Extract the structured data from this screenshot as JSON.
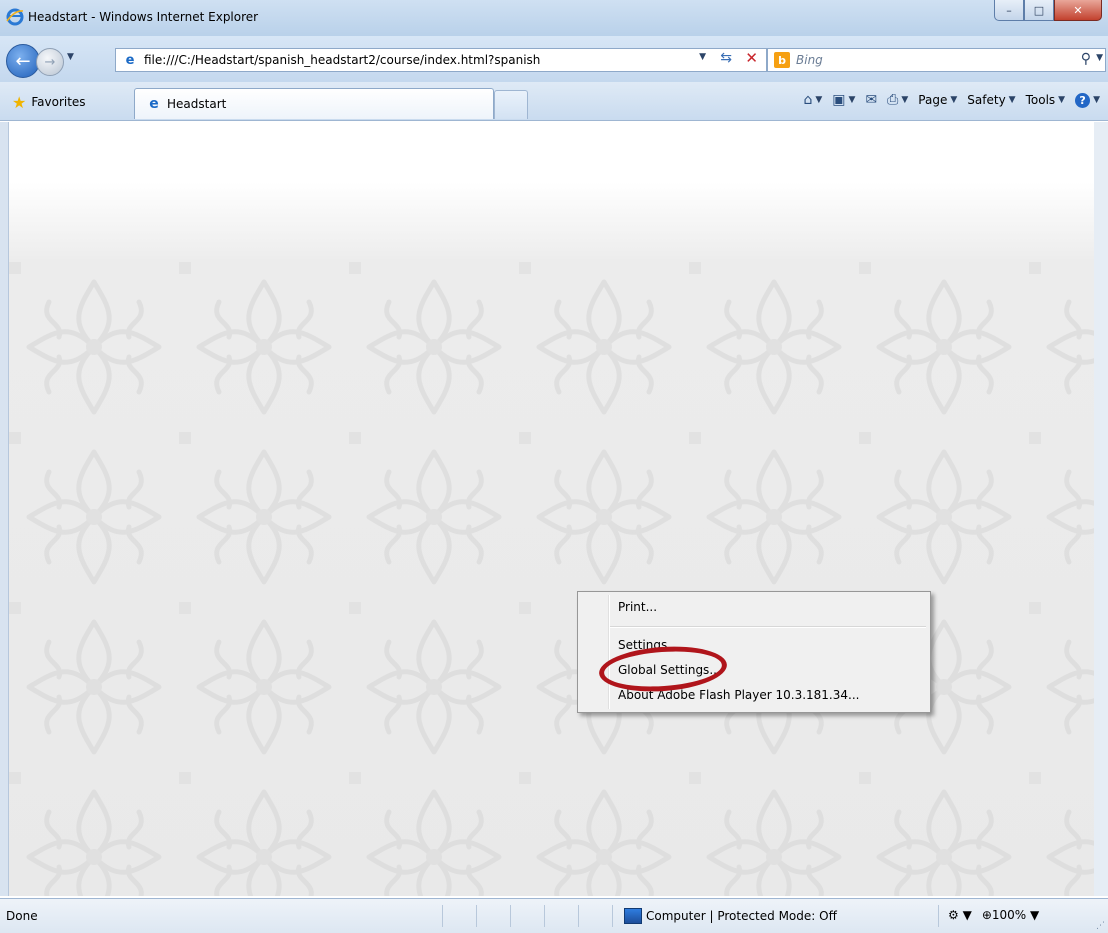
{
  "window": {
    "title": "Headstart - Windows Internet Explorer",
    "minimize_glyph": "–",
    "maximize_glyph": "□",
    "close_glyph": "✕"
  },
  "address_bar": {
    "url": "file:///C:/Headstart/spanish_headstart2/course/index.html?spanish",
    "back_glyph": "←",
    "forward_glyph": "→"
  },
  "search": {
    "placeholder": "Bing",
    "logo_letter": "b"
  },
  "tabs_row": {
    "favorites_label": "Favorites",
    "tab_label": "Headstart",
    "commands": [
      "Page",
      "Safety",
      "Tools"
    ]
  },
  "context_menu": {
    "items": [
      "Print...",
      "Settings...",
      "Global Settings...",
      "About Adobe Flash Player 10.3.181.34..."
    ],
    "highlight_color": "#b0151b"
  },
  "status_bar": {
    "status_text": "Done",
    "zone_text": "Computer | Protected Mode: Off",
    "zoom_text": "100%"
  },
  "icons": {
    "back": "back-arrow-icon",
    "forward": "forward-arrow-icon",
    "ie": "ie-logo-icon",
    "favorites": "star-icon",
    "home": "home-icon",
    "feeds": "rss-icon",
    "mail": "mail-icon",
    "print": "printer-icon",
    "help": "help-icon",
    "search": "magnifier-icon"
  }
}
